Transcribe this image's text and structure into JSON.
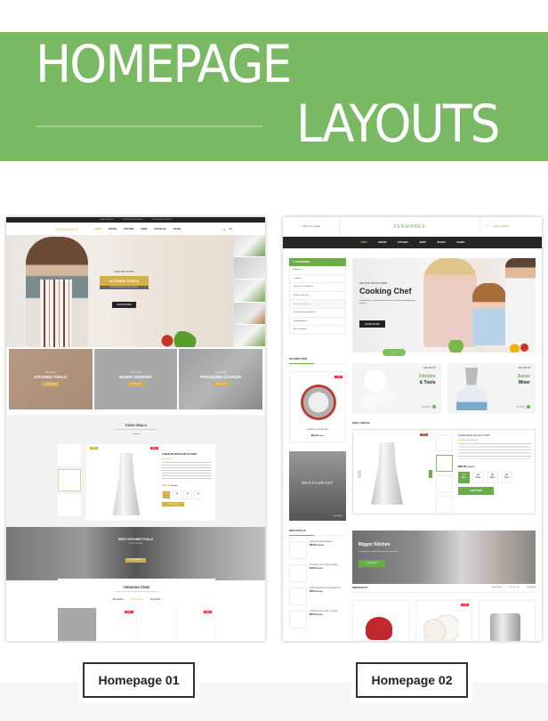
{
  "banner": {
    "title_line1": "HOMEPAGE",
    "title_line2": "LAYOUTS",
    "bg_color": "#79b964"
  },
  "homepage01": {
    "label": "Homepage 01",
    "accent_color": "#d4b04a",
    "topbar": [
      "FREE SHIPPING",
      "WORLDWIDE DELIVERY",
      "24/7 ONLINE SUPPORT"
    ],
    "logo": "ZENWARES",
    "menu": [
      "HOME",
      "DECOR",
      "KITCHEN",
      "SHOP",
      "OUR BLOG",
      "PAGES"
    ],
    "menu_active": "HOME",
    "hero": {
      "sale": "SALE OFF TO 50%",
      "title": "KITCHEN TOOLS",
      "subtitle": "EVERYTHING FROM ALL STORE",
      "button": "LEARN MORE"
    },
    "categories": [
      {
        "small": "NEW STORE",
        "title": "KITCHEN TOOLS",
        "button": "SHOP NOW"
      },
      {
        "small": "NEW STORE",
        "title": "MIXER GRINDER",
        "button": "SHOP NOW"
      },
      {
        "small": "NEW STORE",
        "title": "PRESSURE COOKER",
        "button": "SHOP NOW"
      }
    ],
    "today_deals": {
      "title": "TODAY DEALS",
      "subtitle": "Lorem ipsum dolor sit amet consectetur adipisicing elit",
      "badge_new": "NEW",
      "badge_sale": "SALE",
      "product_name": "LOREM IPSUM DOLOR SIT AMET",
      "stars": "★★★★★",
      "price": "$69.00",
      "old_price": "$125.00",
      "countdown": [
        "00",
        "00",
        "00",
        "00"
      ],
      "button": "SHOP NOW"
    },
    "best_tools": {
      "title": "BEST KITCHEN TOOLS",
      "subtitle": "UP TO 50% OFF",
      "button": "GET STARTED"
    },
    "trending": {
      "title": "TRENDING ITEMS",
      "subtitle": "Lorem ipsum dolor sit amet consectetur adipisicing elit",
      "tabs": [
        "Best Seller",
        "New Arrivals",
        "Top Rated"
      ],
      "active_tab": "New Arrivals",
      "badge_sale": "SALE"
    }
  },
  "homepage02": {
    "label": "Homepage 02",
    "accent_color": "#6aae4a",
    "search_placeholder": "Enter your search...",
    "logo": "ZENWARES",
    "cart": "2 Items - $36.00",
    "menu": [
      "HOME",
      "DECOR",
      "KITCHEN",
      "SHOP",
      "BLOGS",
      "PAGES"
    ],
    "menu_active": "HOME",
    "categories": {
      "title": "CATEGORIES",
      "items": [
        "Bakeware",
        "Cookware",
        "Coffee & Tea & Espresso",
        "Kitchen Linen Sets",
        "Barbeques & Stoves",
        "Icing & Decorating Spatulas",
        "Small Appliances",
        "More Categories"
      ],
      "active_item": "Barbeques & Stoves"
    },
    "hero": {
      "sale": "SALE 50% OFF ALL ITEMS",
      "title": "Cooking Chef",
      "subtitle": "Lorem Ipsum is simply dummy text of the printing and typesetting industry",
      "button": "LEARN MORE"
    },
    "featured": {
      "title": "FEATURED ITEMS",
      "badge": "-15%",
      "name": "SOMPIRE 1022SHROTATO",
      "price": "$25.00",
      "old_price": "$30.00"
    },
    "restaurant": {
      "title": "RESTAURANT",
      "subtitle": "LONDON",
      "link": "Learn More"
    },
    "promos": [
      {
        "sale": "Sale 45% Off",
        "title1": "Kitchen",
        "title2": "& Tools",
        "link": "Shop Now"
      },
      {
        "sale": "Sale 50% Off",
        "title1": "Juicer",
        "title2": "Mixer",
        "link": "Shop Now"
      }
    ],
    "daily_deals": {
      "title": "DAILY DEALS",
      "badge": "-10%",
      "product_name": "LOREM IPSUM DOLOR SIT AMET",
      "stars": "★★★★★",
      "reviews": "(1 Review)",
      "price": "$89.00",
      "old_price": "$125.00",
      "countdown": [
        {
          "value": "22",
          "unit": "Days"
        },
        {
          "value": "20",
          "unit": "Hours"
        },
        {
          "value": "58",
          "unit": "Mins"
        },
        {
          "value": "00",
          "unit": "Secs"
        }
      ],
      "button": "SHOP NOW"
    },
    "most_popular": {
      "title": "MOST POPULAR",
      "items": [
        {
          "name": "INFINI HYDRATION WATER",
          "price": "$85.00",
          "old_price": "$120.00"
        },
        {
          "name": "POLAR BOTTLE TOILETE WATER",
          "price": "$49.00",
          "old_price": "$60.00"
        },
        {
          "name": "KNIFE INSULATED WIDE STAINLESS",
          "price": "$29.00",
          "old_price": "$40.00"
        },
        {
          "name": "SOMPIRE 1022 ROTATO CLASSIC",
          "price": "$29.00",
          "old_price": "$40.00"
        }
      ]
    },
    "bigger_kitchen": {
      "title": "Bigger Kitchen",
      "subtitle": "Lorem Ipsum is simply dummy text of the printing",
      "button": "VIEW MORE"
    },
    "products": {
      "title": "PRODUCTS",
      "tabs": [
        "Best Seller",
        "New Arrivals",
        "Top Rated"
      ],
      "active_tab": "New Arrivals",
      "badge": "-15%"
    }
  }
}
